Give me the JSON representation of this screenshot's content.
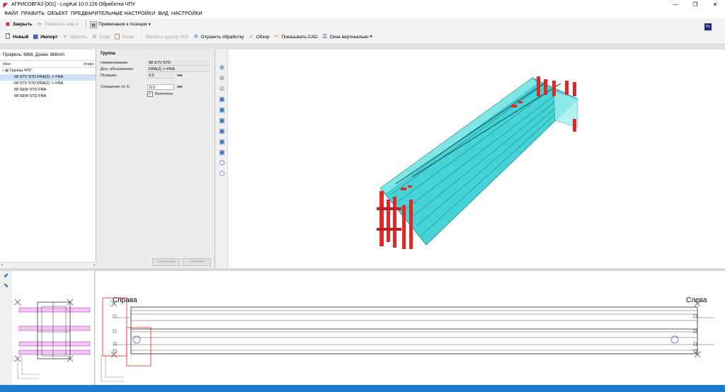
{
  "window": {
    "title": "АГРИСОВГАЗ [001] - LogiKal 10.0.126 Обработка ЧПУ",
    "controls": [
      "minimize",
      "maximize",
      "close"
    ]
  },
  "menu": [
    "ФАЙЛ",
    "ПРАВИТЬ",
    "ОБЪЕКТ",
    "ПРЕДВАРИТЕЛЬНЫЕ НАСТРОЙКИ",
    "ВИД",
    "НАСТРОЙКИ"
  ],
  "toolbar1": {
    "close_label": "Закрыть",
    "change_view_label": "Поменять вид",
    "position_notes_label": "Примечания к позиции"
  },
  "toolbar2": {
    "new_label": "Новый",
    "import_label": "Импорт",
    "delete_label": "Удалить",
    "copy_label": "Copy",
    "paste_label": "Paste",
    "split_group_label": "Разбить группу ЧПУ",
    "mirror_label": "Отразить обработку",
    "overview_label": "Обзор",
    "show_cad_label": "Показывать CAD",
    "windows_vertical_label": "Окна вертикально"
  },
  "ps_badge": "Ps",
  "left_panel": {
    "profile_info": "Профиль: 6856, Длина: 866mm",
    "col_name": "Имя",
    "col_info": "Инфо",
    "root": "Группы ЧПУ",
    "items": [
      {
        "label": "68 STV STD FRA(2) -> FRA",
        "selected": true
      },
      {
        "label": "68 STV STD FRA(2) -> FRA",
        "selected": false
      },
      {
        "label": "68 SEW STD FRA",
        "selected": false
      },
      {
        "label": "68 SEW STD FRA",
        "selected": false
      }
    ]
  },
  "props": {
    "title": "Группа",
    "name_label": "Наименование:",
    "name_value": "68 STV STD",
    "extra_label": "Доп. обозначение:",
    "extra_value": "FRA(2) -> FRA",
    "position_label": "Позиция:",
    "position_value": "0.0",
    "position_unit": "мм",
    "offset_label": "Смещение по X:",
    "offset_value": "0.0",
    "offset_unit": "мм",
    "enabled_label": "Включено",
    "enabled": true,
    "save_label": "Сохранить",
    "cancel_label": "Отмена"
  },
  "drawing": {
    "right_label": "Справа",
    "left_label": "Слева"
  },
  "colors": {
    "accent_blue": "#1e7fd1",
    "profile_cyan": "#3fd0d4",
    "machining_red": "#e02828",
    "selection": "#cde0f5",
    "section_magenta": "#d050d0"
  }
}
